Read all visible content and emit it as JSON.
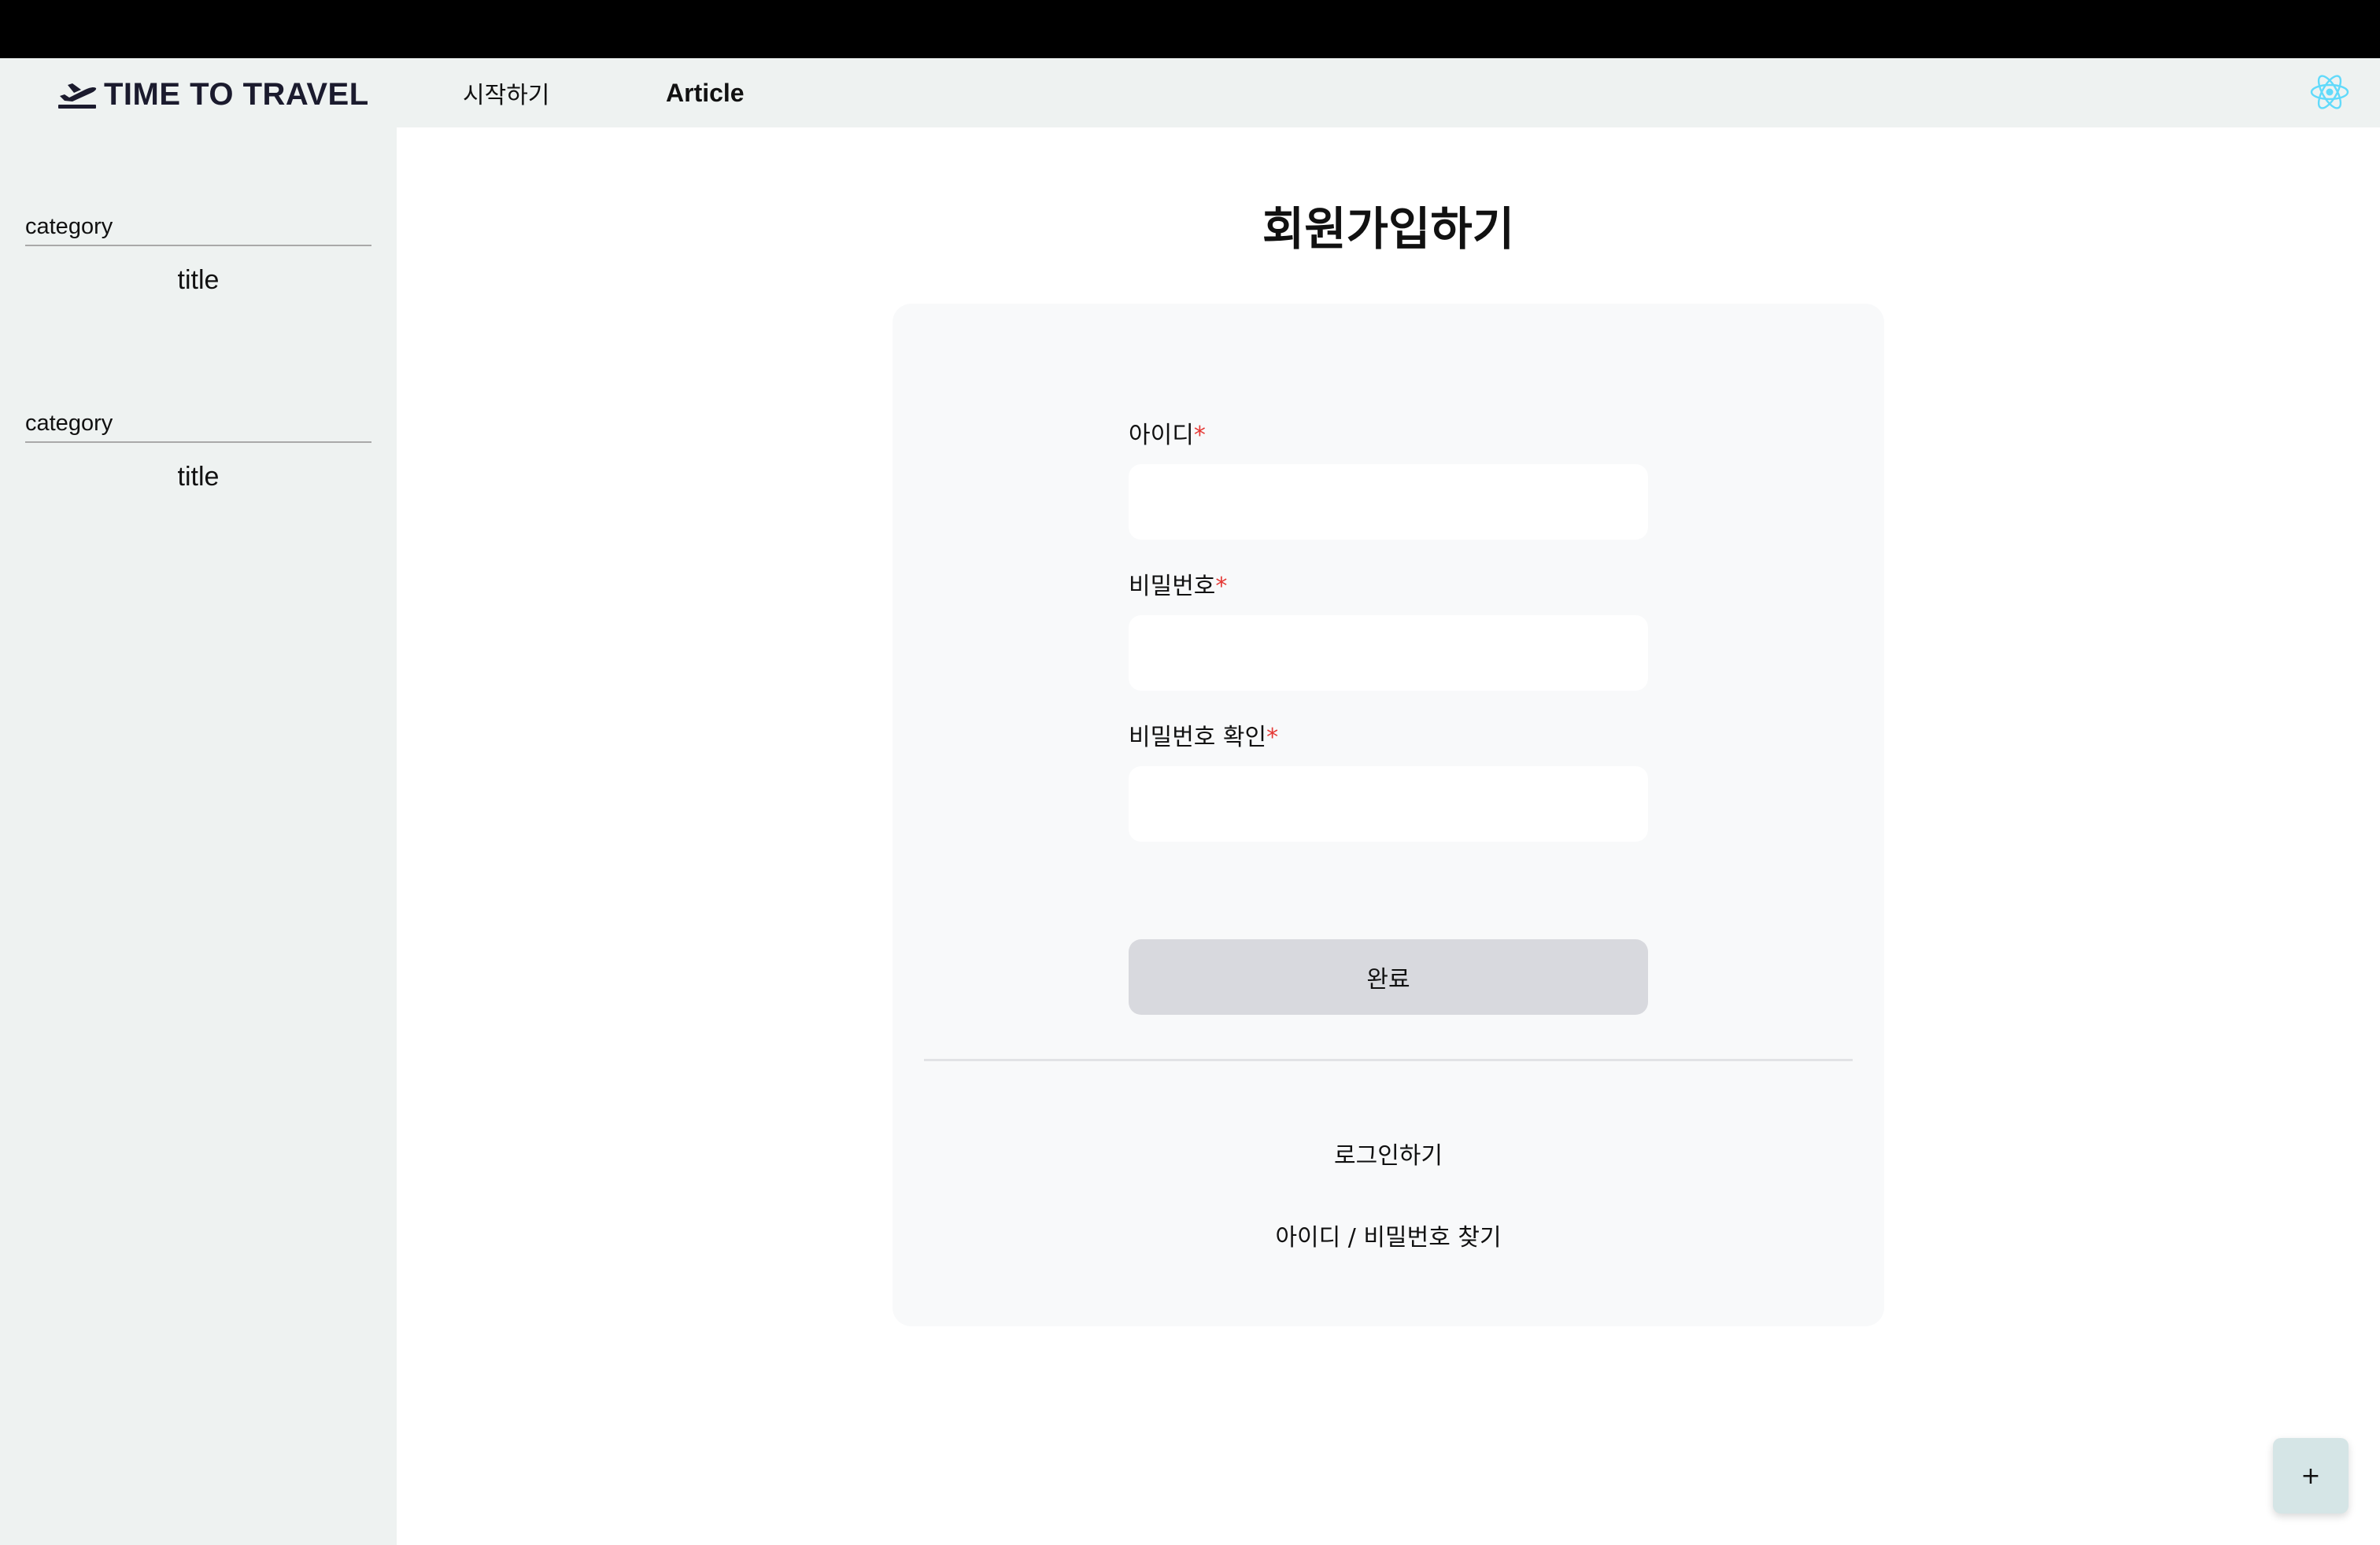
{
  "brand": {
    "name": "TIME TO TRAVEL",
    "icon": "airplane-takeoff-icon"
  },
  "nav": {
    "start_label": "시작하기",
    "article_label": "Article",
    "logo_icon": "react-atom-icon"
  },
  "sidebar": {
    "groups": [
      {
        "category": "category",
        "title": "title"
      },
      {
        "category": "category",
        "title": "title"
      }
    ]
  },
  "main": {
    "page_title": "회원가입하기",
    "form": {
      "fields": [
        {
          "label": "아이디",
          "required_mark": "*",
          "value": ""
        },
        {
          "label": "비밀번호",
          "required_mark": "*",
          "value": ""
        },
        {
          "label": "비밀번호 확인",
          "required_mark": "*",
          "value": ""
        }
      ],
      "submit_label": "완료"
    },
    "links": {
      "login": "로그인하기",
      "find": "아이디 / 비밀번호 찾기"
    }
  },
  "fab": {
    "label": "+"
  },
  "colors": {
    "topbar": "#000000",
    "header_bg": "#eef2f1",
    "sidebar_bg": "#eef2f1",
    "card_bg": "#f8f9fa",
    "button_bg": "#d8d9de",
    "required": "#e53935",
    "fab_bg": "#d5e5e6",
    "react_logo": "#61dafb"
  }
}
